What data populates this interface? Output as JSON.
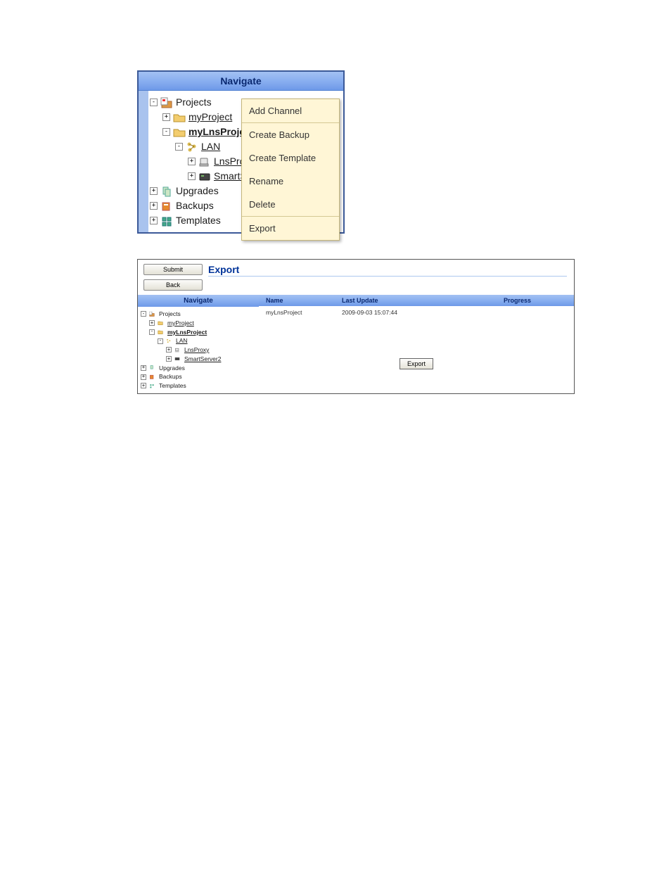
{
  "panel1": {
    "title": "Navigate",
    "tree": {
      "projects": "Projects",
      "myProject": "myProject",
      "myLnsProject": "myLnsProject",
      "lan": "LAN",
      "lnsPro": "LnsPro",
      "smartS": "SmartS",
      "upgrades": "Upgrades",
      "backups": "Backups",
      "templates": "Templates"
    },
    "contextMenu": {
      "addChannel": "Add Channel",
      "createBackup": "Create Backup",
      "createTemplate": "Create Template",
      "rename": "Rename",
      "delete": "Delete",
      "export": "Export"
    }
  },
  "panel2": {
    "submitBtn": "Submit",
    "backBtn": "Back",
    "title": "Export",
    "navTitle": "Navigate",
    "tree": {
      "projects": "Projects",
      "myProject": "myProject",
      "myLnsProject": "myLnsProject",
      "lan": "LAN",
      "lnsProxy": "LnsProxy",
      "smartServer2": "SmartServer2",
      "upgrades": "Upgrades",
      "backups": "Backups",
      "templates": "Templates"
    },
    "tableHeaders": {
      "name": "Name",
      "lastUpdate": "Last Update",
      "progress": "Progress"
    },
    "tableRow": {
      "name": "myLnsProject",
      "lastUpdate": "2009-09-03 15:07:44"
    },
    "exportBtn": "Export"
  }
}
